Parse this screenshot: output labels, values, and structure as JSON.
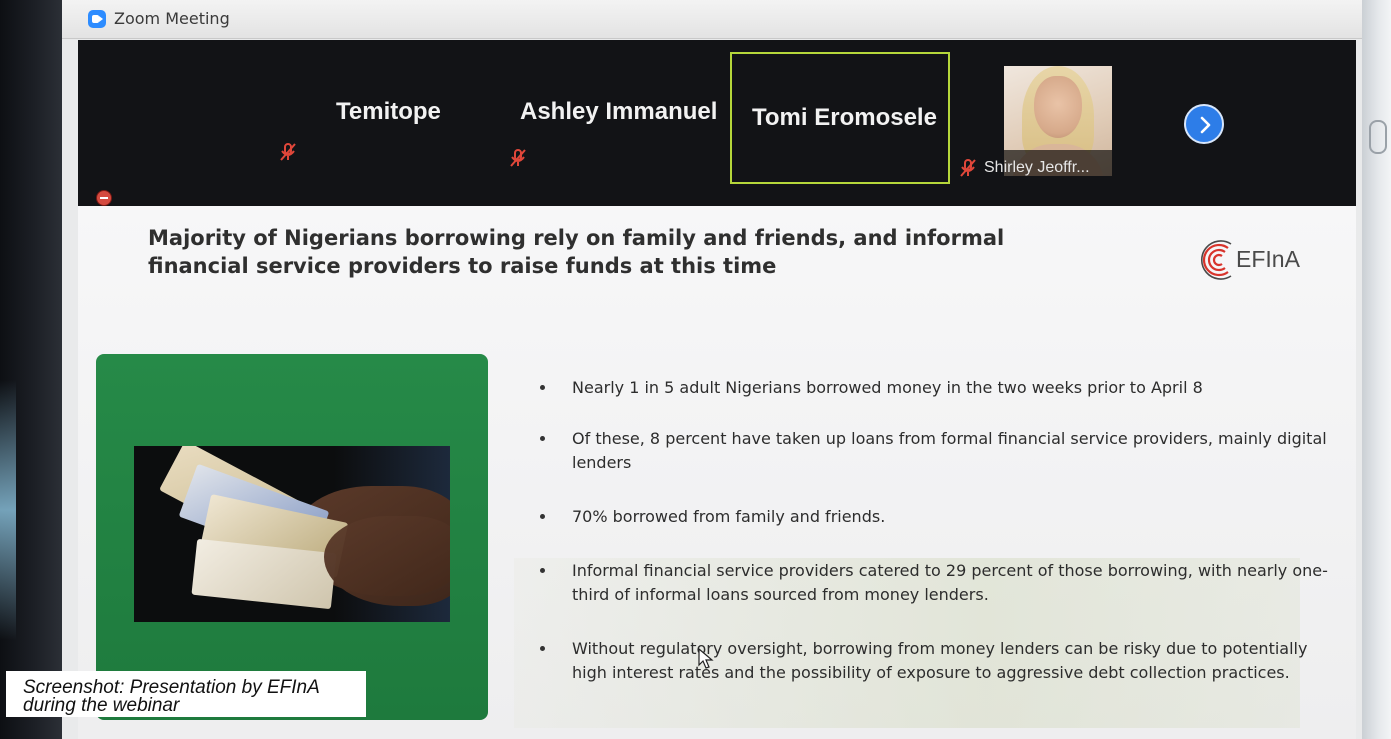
{
  "window": {
    "title": "Zoom Meeting"
  },
  "participants": [
    {
      "name": "Temitope",
      "muted": true
    },
    {
      "name": "Ashley Immanuel",
      "muted": true
    },
    {
      "name": "Tomi Eromosele",
      "active_speaker": true
    },
    {
      "name": "Shirley Jeoffr...",
      "muted": true,
      "video": true
    }
  ],
  "icons": {
    "app": "zoom-camera-icon",
    "mute": "muted-mic-icon",
    "next": "chevron-right-icon",
    "record": "recording-icon",
    "cursor": "mouse-pointer-icon"
  },
  "slide": {
    "title": "Majority of Nigerians borrowing rely on family and friends, and informal financial service providers to raise funds at this time",
    "logo_text": "EFInA",
    "bullets": [
      "Nearly 1 in 5 adult Nigerians borrowed money in the two weeks prior to April 8",
      " Of these, 8 percent have taken up loans from formal financial service providers, mainly digital lenders",
      "70% borrowed from family and friends.",
      "Informal financial service providers catered to 29 percent of those borrowing, with nearly one-third of informal loans sourced from money lenders.",
      "Without regulatory oversight, borrowing from money lenders can be risky due to potentially high interest rates and the possibility of exposure to aggressive debt collection practices."
    ]
  },
  "caption": {
    "line1": "Screenshot: Presentation by EFInA",
    "line2": "during the webinar"
  },
  "colors": {
    "zoom_blue": "#2d8cff",
    "active_speaker_border": "#b5d63a",
    "mute_red": "#e0473a",
    "slide_green": "#268a48",
    "logo_red": "#d8342c"
  }
}
